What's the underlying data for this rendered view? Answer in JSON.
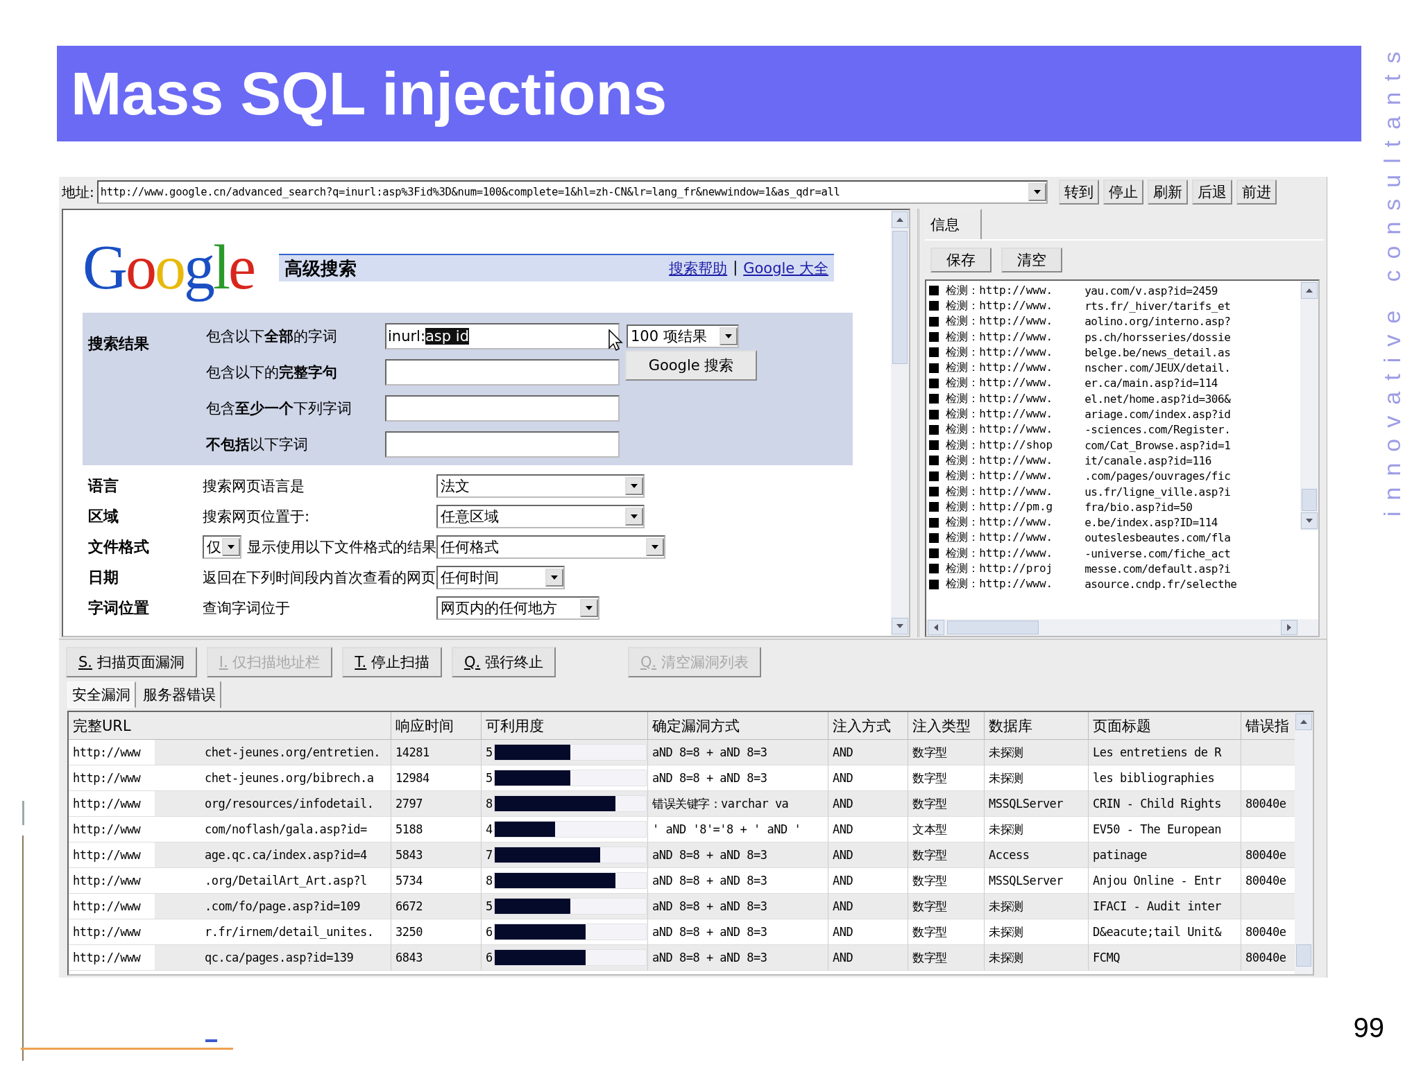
{
  "slide": {
    "title": "Mass SQL injections",
    "tagline": "innovative consultants",
    "page_number": "99"
  },
  "address_bar": {
    "label": "地址:",
    "url": "http://www.google.cn/advanced_search?q=inurl:asp%3Fid%3D&num=100&complete=1&hl=zh-CN&lr=lang_fr&newwindow=1&as_qdr=all",
    "buttons": [
      "转到",
      "停止",
      "刷新",
      "后退",
      "前进"
    ]
  },
  "browser": {
    "logo": "Google",
    "header": "高级搜索",
    "links": [
      "搜索帮助",
      "Google 大全"
    ],
    "separator": "|",
    "search_section": "搜索结果",
    "fields": [
      {
        "label": "包含以下**全部**的字词",
        "value": "inurl:",
        "selection": "asp id"
      },
      {
        "label": "包含以下的**完整字句**"
      },
      {
        "label": "包含**至少一个**下列字词"
      },
      {
        "label": "**不包括**以下字词"
      }
    ],
    "results_select": "100 项结果",
    "search_button": "Google 搜索",
    "options": [
      {
        "name": "语言",
        "label": "搜索网页语言是",
        "select": "法文"
      },
      {
        "name": "区域",
        "label": "搜索网页位置于:",
        "select": "任意区域"
      },
      {
        "name": "文件格式",
        "pre_select": "仅",
        "label": "显示使用以下文件格式的结果",
        "select": "任何格式"
      },
      {
        "name": "日期",
        "label": "返回在下列时间段内首次查看的网页",
        "select": "任何时间"
      },
      {
        "name": "字词位置",
        "label": "查询字词位于",
        "select": "网页内的任何地方"
      }
    ]
  },
  "info_panel": {
    "tab": "信息",
    "buttons": [
      "保存",
      "清空"
    ],
    "log": [
      {
        "prefix": "检测：http://www.",
        "url_end": "yau.com/v.asp?id=2459"
      },
      {
        "prefix": "检测：http://www.",
        "url_end": "rts.fr/_hiver/tarifs_et"
      },
      {
        "prefix": "检测：http://www.",
        "url_end": "aolino.org/interno.asp?"
      },
      {
        "prefix": "检测：http://www.",
        "url_end": "ps.ch/horsseries/dossie"
      },
      {
        "prefix": "检测：http://www.",
        "url_end": "belge.be/news_detail.as"
      },
      {
        "prefix": "检测：http://www.",
        "url_end": "nscher.com/JEUX/detail."
      },
      {
        "prefix": "检测：http://www.",
        "url_end": "er.ca/main.asp?id=114"
      },
      {
        "prefix": "检测：http://www.",
        "url_end": "el.net/home.asp?id=306&"
      },
      {
        "prefix": "检测：http://www.",
        "url_end": "ariage.com/index.asp?id"
      },
      {
        "prefix": "检测：http://www.",
        "url_end": "-sciences.com/Register."
      },
      {
        "prefix": "检测：http://shop",
        "url_end": "com/Cat_Browse.asp?id=1"
      },
      {
        "prefix": "检测：http://www.",
        "url_end": "it/canale.asp?id=116"
      },
      {
        "prefix": "检测：http://www.",
        "url_end": ".com/pages/ouvrages/fic"
      },
      {
        "prefix": "检测：http://www.",
        "url_end": "us.fr/ligne_ville.asp?i"
      },
      {
        "prefix": "检测：http://pm.g",
        "url_end": "fra/bio.asp?id=50"
      },
      {
        "prefix": "检测：http://www.",
        "url_end": "e.be/index.asp?ID=114"
      },
      {
        "prefix": "检测：http://www.",
        "url_end": "outeslesbeautes.com/fla"
      },
      {
        "prefix": "检测：http://www.",
        "url_end": "-universe.com/fiche_act"
      },
      {
        "prefix": "检测：http://proj",
        "url_end": "messe.com/default.asp?i"
      },
      {
        "prefix": "检测：http://www.",
        "url_end": "asource.cndp.fr/selecthe"
      }
    ]
  },
  "scanner": {
    "buttons": [
      {
        "key": "S.",
        "label": "扫描页面漏洞",
        "disabled": false
      },
      {
        "key": "I.",
        "label": "仅扫描地址栏",
        "disabled": true
      },
      {
        "key": "T.",
        "label": "停止扫描",
        "disabled": false
      },
      {
        "key": "Q.",
        "label": "强行终止",
        "disabled": false
      },
      {
        "key": "Q.",
        "label": "清空漏洞列表",
        "disabled": true
      }
    ],
    "tabs": [
      {
        "label": "安全漏洞",
        "selected": true
      },
      {
        "label": "服务器错误",
        "selected": false
      }
    ],
    "columns": [
      "完整URL",
      "响应时间",
      "可利用度",
      "确定漏洞方式",
      "注入方式",
      "注入类型",
      "数据库",
      "页面标题",
      "错误指"
    ],
    "rows": [
      {
        "url_start": "http://www",
        "url_end": "chet-jeunes.org/entretien.",
        "time": "14281",
        "score": "5",
        "level": 0.5,
        "method": "aND 8=8 +  aND 8=3",
        "injection": "AND",
        "type": "数字型",
        "database": "未探测",
        "page_title": "Les entretiens de R"
      },
      {
        "url_start": "http://www",
        "url_end": "chet-jeunes.org/bibrech.a",
        "time": "12984",
        "score": "5",
        "level": 0.5,
        "method": "aND 8=8 +  aND 8=3",
        "injection": "AND",
        "type": "数字型",
        "database": "未探测",
        "page_title": "les bibliographies"
      },
      {
        "url_start": "http://www",
        "url_end": "org/resources/infodetail.",
        "time": "2797",
        "score": "8",
        "level": 0.8,
        "method": "错误关键字：varchar va",
        "injection": "AND",
        "type": "数字型",
        "database": "MSSQLServer",
        "page_title": "CRIN - Child Rights",
        "error": "80040e"
      },
      {
        "url_start": "http://www",
        "url_end": "com/noflash/gala.asp?id=",
        "time": "5188",
        "score": "4",
        "level": 0.4,
        "method": "' aND '8'='8 + ' aND '",
        "injection": "AND",
        "type": "文本型",
        "database": "未探测",
        "page_title": "EV50 - The European"
      },
      {
        "url_start": "http://www",
        "url_end": "age.qc.ca/index.asp?id=4",
        "time": "5843",
        "score": "7",
        "level": 0.7,
        "method": "aND 8=8 +  aND 8=3",
        "injection": "AND",
        "type": "数字型",
        "database": "Access",
        "page_title": "patinage",
        "error": "80040e"
      },
      {
        "url_start": "http://www",
        "url_end": ".org/DetailArt_Art.asp?l",
        "time": "5734",
        "score": "8",
        "level": 0.8,
        "method": "aND 8=8 +  aND 8=3",
        "injection": "AND",
        "type": "数字型",
        "database": "MSSQLServer",
        "page_title": "Anjou Online - Entr",
        "error": "80040e"
      },
      {
        "url_start": "http://www",
        "url_end": ".com/fo/page.asp?id=109",
        "time": "6672",
        "score": "5",
        "level": 0.5,
        "method": "aND 8=8 +  aND 8=3",
        "injection": "AND",
        "type": "数字型",
        "database": "未探测",
        "page_title": "IFACI - Audit inter"
      },
      {
        "url_start": "http://www",
        "url_end": "r.fr/irnem/detail_unites.",
        "time": "3250",
        "score": "6",
        "level": 0.6,
        "method": "aND 8=8 +  aND 8=3",
        "injection": "AND",
        "type": "数字型",
        "database": "未探测",
        "page_title": "D&eacute;tail Unit&",
        "error": "80040e"
      },
      {
        "url_start": "http://www",
        "url_end": "qc.ca/pages.asp?id=139",
        "time": "6843",
        "score": "6",
        "level": 0.6,
        "method": "aND 8=8 +  aND 8=3",
        "injection": "AND",
        "type": "数字型",
        "database": "未探测",
        "page_title": "FCMQ",
        "error": "80040e"
      }
    ]
  }
}
